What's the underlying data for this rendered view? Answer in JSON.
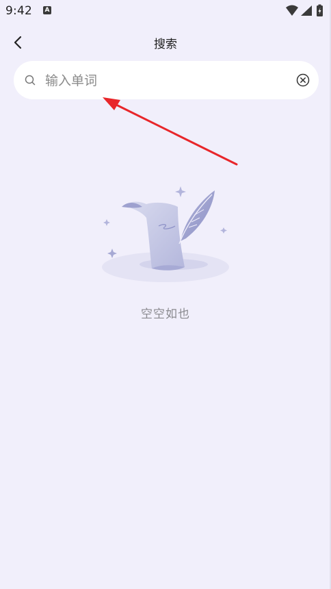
{
  "status_bar": {
    "time": "9:42",
    "app_icon_letter": "A",
    "icons": [
      "wifi-icon",
      "signal-icon",
      "battery-charging-icon"
    ]
  },
  "header": {
    "title": "搜索",
    "back_icon": "chevron-left-icon"
  },
  "search": {
    "placeholder": "输入单词",
    "value": "",
    "search_icon": "search-icon",
    "clear_icon": "clear-circle-icon"
  },
  "empty_state": {
    "illustration": "scroll-and-quill-illustration",
    "text": "空空如也"
  },
  "colors": {
    "background": "#f1effb",
    "search_bg": "#ffffff",
    "annotation_arrow": "#e8262a",
    "illustration_primary": "#aeb0d6"
  }
}
